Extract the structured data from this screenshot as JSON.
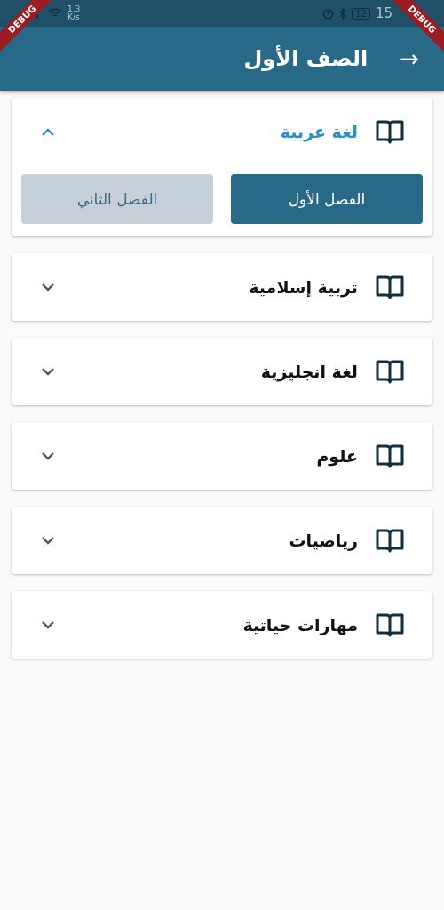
{
  "status_bar": {
    "network_speed": "1.3",
    "network_unit": "K/s",
    "battery": "12",
    "time": "15"
  },
  "debug_banners": [
    "DEBUG",
    "DEBUG"
  ],
  "app_bar": {
    "title": "الصف الأول",
    "back": "→"
  },
  "subjects": [
    {
      "name": "لغة عربية",
      "expanded": true,
      "semesters": [
        {
          "label": "الفصل الأول",
          "selected": true
        },
        {
          "label": "الفصل الثاني",
          "selected": false
        }
      ]
    },
    {
      "name": "تربية إسلامية",
      "expanded": false
    },
    {
      "name": "لغة انجليزية",
      "expanded": false
    },
    {
      "name": "علوم",
      "expanded": false
    },
    {
      "name": "رياضيات",
      "expanded": false
    },
    {
      "name": "مهارات حياتية",
      "expanded": false
    }
  ]
}
